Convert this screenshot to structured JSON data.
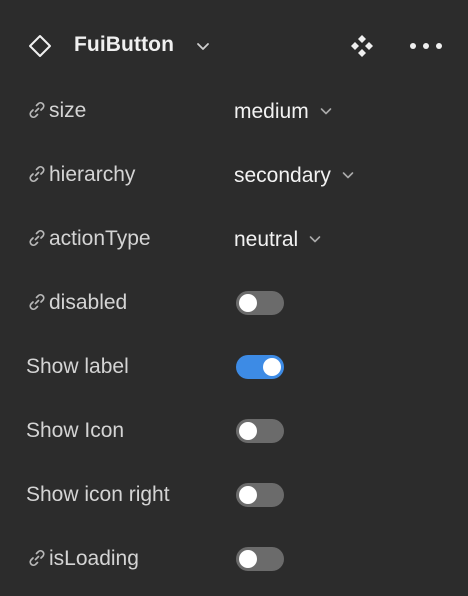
{
  "header": {
    "title": "FuiButton",
    "component_icon": "component-diamond-icon",
    "chevron_icon": "chevron-down-icon",
    "instance_icon": "instance-icon",
    "more_icon": "more-horizontal-icon"
  },
  "properties": [
    {
      "label": "size",
      "variant": true,
      "type": "dropdown",
      "value": "medium"
    },
    {
      "label": "hierarchy",
      "variant": true,
      "type": "dropdown",
      "value": "secondary"
    },
    {
      "label": "actionType",
      "variant": true,
      "type": "dropdown",
      "value": "neutral"
    },
    {
      "label": "disabled",
      "variant": true,
      "type": "toggle",
      "on": false
    },
    {
      "label": "Show label",
      "variant": false,
      "type": "toggle",
      "on": true
    },
    {
      "label": "Show Icon",
      "variant": false,
      "type": "toggle",
      "on": false
    },
    {
      "label": "Show icon right",
      "variant": false,
      "type": "toggle",
      "on": false
    },
    {
      "label": "isLoading",
      "variant": true,
      "type": "toggle",
      "on": false
    }
  ],
  "colors": {
    "background": "#2c2c2c",
    "toggle_on": "#3d8be5",
    "toggle_off": "#6b6b6b"
  }
}
